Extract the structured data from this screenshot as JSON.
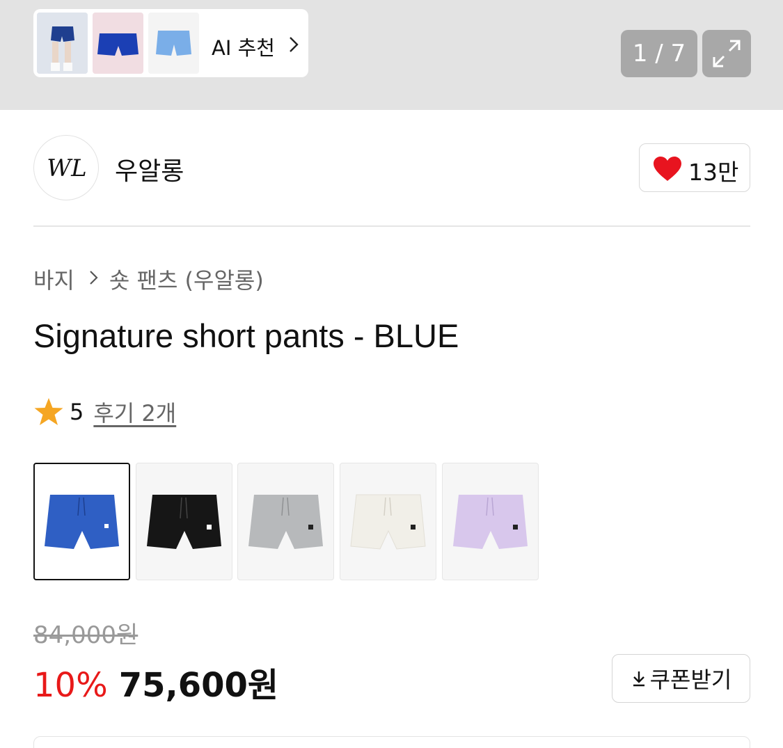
{
  "gallery": {
    "ai_recommend_label": "AI 추천",
    "counter": "1 / 7",
    "thumbnails": [
      "model-photo",
      "blue-shorts-pink-bg",
      "light-blue-shorts"
    ]
  },
  "brand": {
    "logo_text": "WL",
    "name": "우알롱",
    "like_count": "13만"
  },
  "breadcrumb": {
    "category": "바지",
    "subcategory": "숏 팬츠 (우알롱)"
  },
  "product": {
    "title": "Signature short pants - BLUE",
    "rating": "5",
    "review_link": "후기 2개"
  },
  "color_options": [
    {
      "name": "blue",
      "color": "#2f5fc4",
      "selected": true
    },
    {
      "name": "black",
      "color": "#161616",
      "selected": false
    },
    {
      "name": "gray",
      "color": "#b7b9bb",
      "selected": false
    },
    {
      "name": "ivory",
      "color": "#f1efe8",
      "selected": false
    },
    {
      "name": "lavender",
      "color": "#d8c7ec",
      "selected": false
    }
  ],
  "price": {
    "original": "84,000원",
    "discount": "10%",
    "final": "75,600원",
    "coupon_button": "쿠폰받기"
  },
  "colors": {
    "accent_red": "#e81919",
    "heart": "#e8141f",
    "star": "#f5a623"
  }
}
